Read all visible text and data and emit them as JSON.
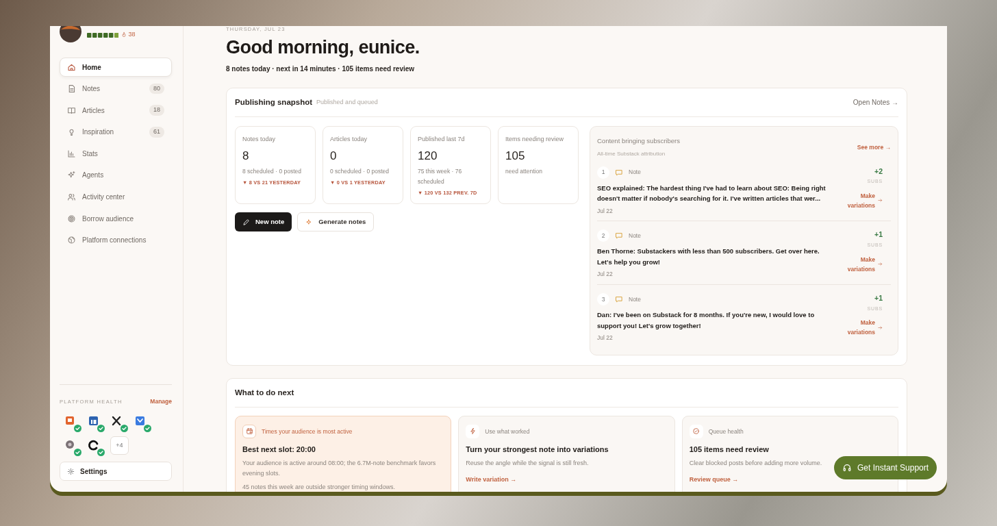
{
  "user": {
    "streak": "38"
  },
  "sidebar": {
    "items": [
      {
        "label": "Home",
        "kind": "home",
        "selected": true
      },
      {
        "label": "Notes",
        "kind": "doc",
        "count": "80",
        "selected": false
      },
      {
        "label": "Articles",
        "kind": "book",
        "count": "18",
        "selected": false
      },
      {
        "label": "Inspiration",
        "kind": "bulb",
        "count": "61",
        "selected": false
      },
      {
        "label": "Stats",
        "kind": "chart",
        "selected": false
      },
      {
        "label": "Agents",
        "kind": "sparkle",
        "selected": false
      },
      {
        "label": "Activity center",
        "kind": "people",
        "selected": false
      },
      {
        "label": "Borrow audience",
        "kind": "target",
        "selected": false
      },
      {
        "label": "Platform connections",
        "kind": "globe",
        "selected": false
      }
    ],
    "health_title": "PLATFORM HEALTH",
    "manage": "Manage",
    "platforms": [
      {
        "kind": "orange",
        "connected": true
      },
      {
        "kind": "linkedin",
        "connected": true
      },
      {
        "kind": "x",
        "connected": true
      },
      {
        "kind": "bluesky",
        "connected": true
      },
      {
        "kind": "dot",
        "connected": true
      },
      {
        "kind": "threads",
        "connected": true
      }
    ],
    "more": "+4",
    "settings": "Settings"
  },
  "header": {
    "date": "THURSDAY, JUL 23",
    "greeting": "Good morning, eunice.",
    "summary": "8 notes today · next in 14 minutes · 105 items need review"
  },
  "snapshot": {
    "title": "Publishing snapshot",
    "subtitle": "Published and queued",
    "link": "Open Notes →",
    "stats": [
      {
        "label": "Notes today",
        "value": "8",
        "detail": "8 scheduled · 0 posted",
        "trend": "▼ 8 VS 21 YESTERDAY"
      },
      {
        "label": "Articles today",
        "value": "0",
        "detail": "0 scheduled · 0 posted",
        "trend": "▼ 0 VS 1 YESTERDAY"
      },
      {
        "label": "Published last 7d",
        "value": "120",
        "detail": "75 this week · 76 scheduled",
        "trend": "▼ 120 VS 132 PREV. 7D"
      },
      {
        "label": "Items needing review",
        "value": "105",
        "detail": "need attention"
      }
    ],
    "buttons": [
      {
        "label": "New note",
        "kind": "primary"
      },
      {
        "label": "Generate notes",
        "kind": "secondary"
      }
    ],
    "subscribers": {
      "title": "Content bringing subscribers",
      "subtitle": "All-time Substack attribution",
      "link": "See more →",
      "items": [
        {
          "rank": "1",
          "type": "Note",
          "text": "SEO explained: The hardest thing I've had to learn about SEO: Being right doesn't matter if nobody's searching for it. I've written articles that wer...",
          "date": "Jul 22",
          "subs": "+2",
          "subs_label": "SUBS",
          "action": "Make variations"
        },
        {
          "rank": "2",
          "type": "Note",
          "text": "Ben Thorne: Substackers with less than 500 subscribers. Get over here. Let's help you grow!",
          "date": "Jul 22",
          "subs": "+1",
          "subs_label": "SUBS",
          "action": "Make variations"
        },
        {
          "rank": "3",
          "type": "Note",
          "text": "Dan: I've been on Substack for 8 months. If you're new, I would love to support you! Let's grow together!",
          "date": "Jul 22",
          "subs": "+1",
          "subs_label": "SUBS",
          "action": "Make variations"
        }
      ]
    }
  },
  "next": {
    "title": "What to do next",
    "cards": [
      {
        "kind": "calendar",
        "tag": "Times your audience is most active",
        "title": "Best next slot: 20:00",
        "body": [
          "Your audience is active around 08:00; the 6.7M-note benchmark favors evening slots.",
          "45 notes this week are outside stronger timing windows."
        ],
        "highlighted": true
      },
      {
        "kind": "bolt",
        "tag": "Use what worked",
        "title": "Turn your strongest note into variations",
        "body": [
          "Reuse the angle while the signal is still fresh."
        ],
        "link": "Write variation →",
        "highlighted": false
      },
      {
        "kind": "check",
        "tag": "Queue health",
        "title": "105 items need review",
        "body": [
          "Clear blocked posts before adding more volume."
        ],
        "link": "Review queue →",
        "highlighted": false
      }
    ]
  },
  "support": "Get Instant Support"
}
